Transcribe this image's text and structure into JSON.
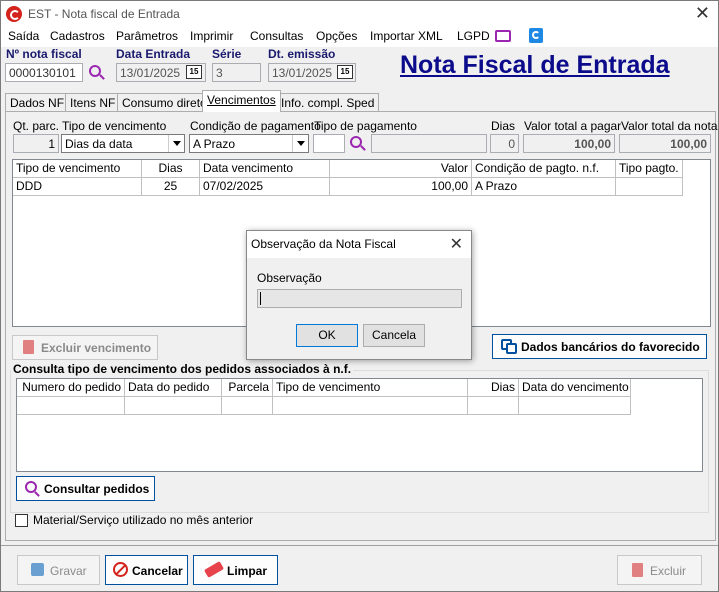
{
  "window": {
    "title": "EST - Nota fiscal de Entrada",
    "close_glyph": "✕"
  },
  "menu": [
    "Saída",
    "Cadastros",
    "Parâmetros",
    "Imprimir",
    "Consultas",
    "Opções",
    "Importar XML",
    "LGPD"
  ],
  "header": {
    "nf_label": "Nº nota fiscal",
    "nf_value": "0000130101",
    "entry_date_label": "Data Entrada",
    "entry_date_value": "13/01/2025",
    "series_label": "Série",
    "series_value": "3",
    "emission_label": "Dt. emissão",
    "emission_value": "13/01/2025",
    "calendar_glyph": "15",
    "big_title": "Nota Fiscal de Entrada"
  },
  "tabs": [
    "Dados NF",
    "Itens NF",
    "Consumo direto",
    "Vencimentos",
    "Info. compl. Sped"
  ],
  "active_tab": "Vencimentos",
  "vencimentos": {
    "qt_parc_label": "Qt. parc.",
    "qt_parc_value": "1",
    "tipo_venc_label": "Tipo de vencimento",
    "tipo_venc_value": "Dias da data",
    "cond_pag_label": "Condição de pagamento",
    "cond_pag_value": "A Prazo",
    "tipo_pag_label": "Tipo de pagamento",
    "tipo_pag_value": "",
    "dias_label": "Dias",
    "dias_value": "0",
    "valor_pagar_label": "Valor total a pagar",
    "valor_pagar_value": "100,00",
    "valor_nota_label": "Valor total da nota",
    "valor_nota_value": "100,00"
  },
  "venc_table": {
    "columns": [
      "Tipo de vencimento",
      "Dias",
      "Data vencimento",
      "Valor",
      "Condição de pagto. n.f.",
      "Tipo pagto."
    ],
    "rows": [
      [
        "DDD",
        "25",
        "07/02/2025",
        "100,00",
        "A Prazo",
        ""
      ]
    ]
  },
  "buttons": {
    "excluir_vencimento": "Excluir vencimento",
    "dados_bancarios": "Dados bancários do favorecido",
    "consultar_pedidos": "Consultar pedidos",
    "gravar": "Gravar",
    "cancelar": "Cancelar",
    "limpar": "Limpar",
    "excluir": "Excluir"
  },
  "pedidos": {
    "group_title": "Consulta tipo de vencimento dos pedidos associados à n.f.",
    "columns": [
      "Numero do pedido",
      "Data do pedido",
      "Parcela",
      "Tipo de vencimento",
      "Dias",
      "Data do vencimento"
    ]
  },
  "checkbox_label": "Material/Serviço utilizado no mês anterior",
  "dialog": {
    "title": "Observação da Nota Fiscal",
    "field_label": "Observação",
    "field_value": "",
    "ok": "OK",
    "cancel": "Cancela",
    "close_glyph": "✕"
  },
  "colors": {
    "accent": "#0b0b8c",
    "header_label": "#1a1a6e",
    "danger": "#d4231c",
    "link_blue": "#0050a0"
  }
}
